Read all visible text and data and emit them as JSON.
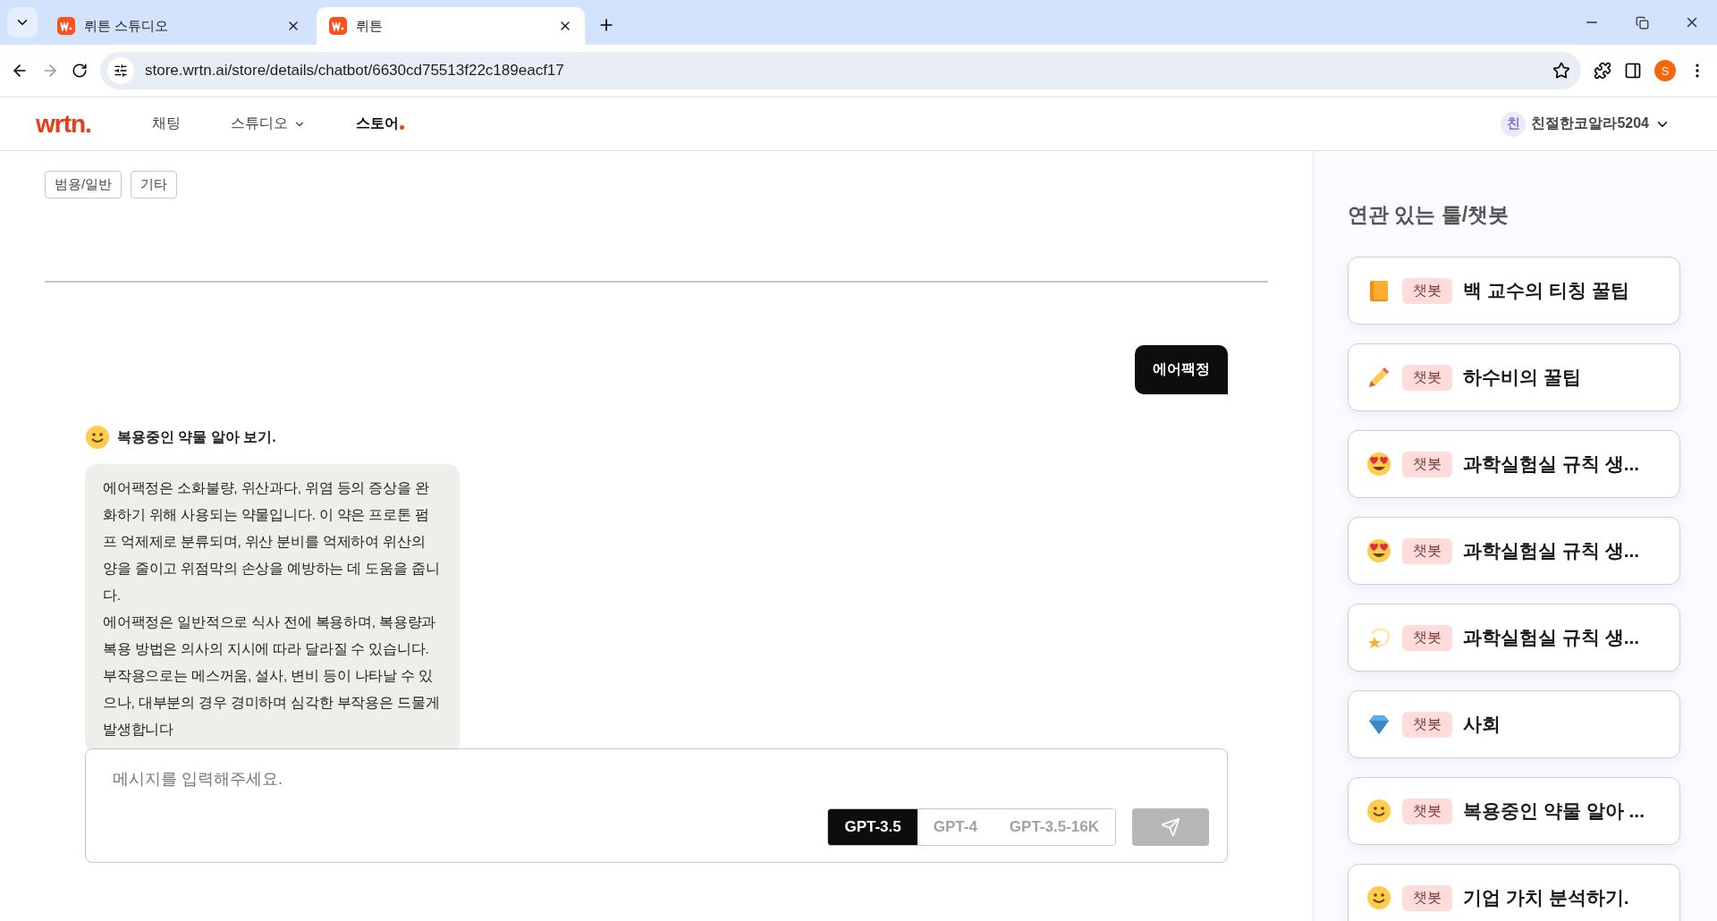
{
  "browser": {
    "tabs": [
      {
        "title": "뤼튼 스튜디오",
        "selected": false
      },
      {
        "title": "뤼튼",
        "selected": true
      }
    ],
    "url": "store.wrtn.ai/store/details/chatbot/6630cd75513f22c189eacf17",
    "profile_initial": "S"
  },
  "header": {
    "logo": "wrtn.",
    "nav": [
      {
        "label": "채팅",
        "selected": false,
        "has_menu": false
      },
      {
        "label": "스튜디오",
        "selected": false,
        "has_menu": true
      },
      {
        "label": "스토어",
        "selected": true,
        "has_menu": false
      }
    ],
    "user": {
      "initial": "친",
      "name": "친절한코알라5204"
    }
  },
  "tags": [
    "범용/일반",
    "기타"
  ],
  "chat": {
    "user_message": "에어팩정",
    "bot_name": "복용중인 약물 알아 보기.",
    "bot_message": [
      "에어팩정은 소화불량, 위산과다, 위염 등의 증상을 완화하기 위해 사용되는 약물입니다. 이 약은 프로톤 펌프 억제제로 분류되며, 위산 분비를 억제하여 위산의 양을 줄이고 위점막의 손상을 예방하는 데 도움을 줍니다.",
      "에어팩정은 일반적으로 식사 전에 복용하며, 복용량과 복용 방법은 의사의 지시에 따라 달라질 수 있습니다. 부작용으로는 메스꺼움, 설사, 변비 등이 나타날 수 있으나, 대부분의 경우 경미하며 심각한 부작용은 드물게 발생합니다"
    ]
  },
  "composer": {
    "placeholder": "메시지를 입력해주세요.",
    "models": [
      {
        "label": "GPT-3.5",
        "selected": true
      },
      {
        "label": "GPT-4",
        "selected": false
      },
      {
        "label": "GPT-3.5-16K",
        "selected": false
      }
    ],
    "send_disabled": true
  },
  "related": {
    "title": "연관 있는 툴/챗봇",
    "items": [
      {
        "badge": "챗봇",
        "title": "백 교수의 티칭 꿀팁"
      },
      {
        "badge": "챗봇",
        "title": "하수비의 꿀팁"
      },
      {
        "badge": "챗봇",
        "title": "과학실험실 규칙 생..."
      },
      {
        "badge": "챗봇",
        "title": "과학실험실 규칙 생..."
      },
      {
        "badge": "챗봇",
        "title": "과학실험실 규칙 생..."
      },
      {
        "badge": "챗봇",
        "title": "사회"
      },
      {
        "badge": "챗봇",
        "title": "복용중인 약물 알아 ..."
      },
      {
        "badge": "챗봇",
        "title": "기업 가치 분석하기."
      }
    ]
  }
}
